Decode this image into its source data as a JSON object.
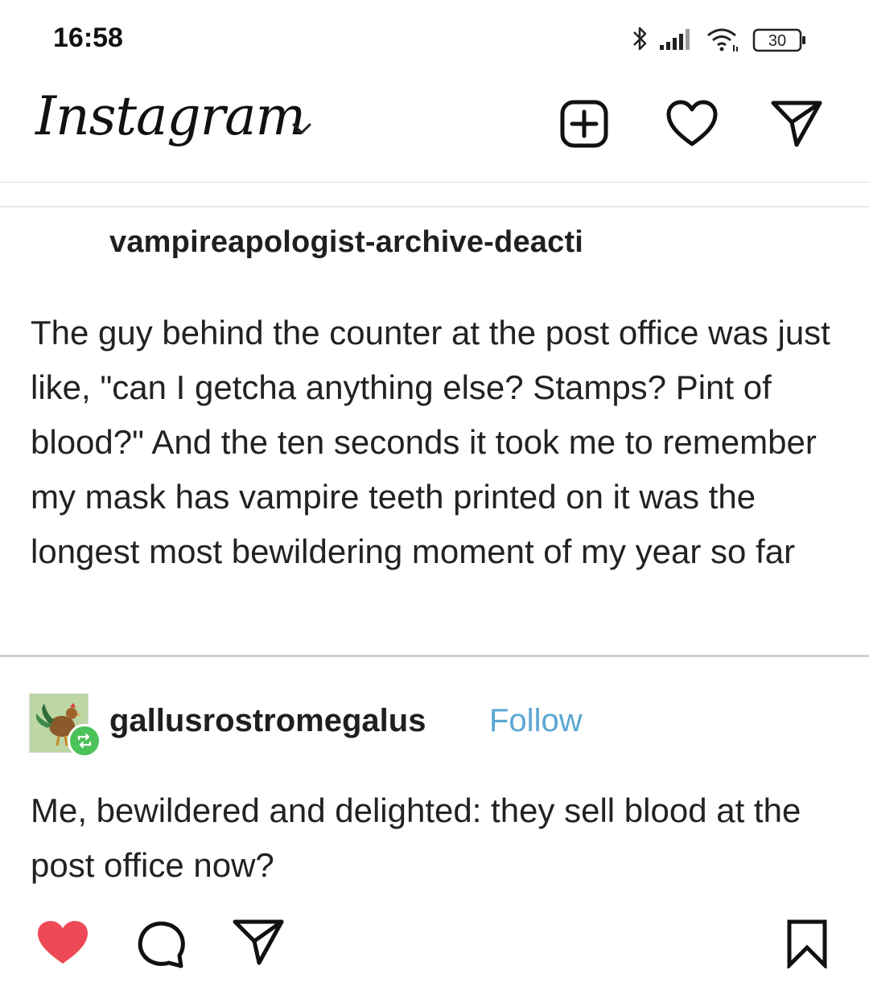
{
  "status_bar": {
    "time": "16:58",
    "battery": "30",
    "icons": [
      "bluetooth-icon",
      "signal-icon",
      "wifi-icon",
      "battery-icon"
    ]
  },
  "header": {
    "logo": "Instagram",
    "icons": [
      "chevron-down-icon",
      "new-post-icon",
      "heart-icon",
      "direct-message-icon"
    ]
  },
  "post": {
    "original": {
      "username": "vampireapologist-archive-deacti",
      "text": "The guy behind the counter at the post office was just like, \"can I getcha anything else? Stamps? Pint of blood?\" And the ten seconds it took me to remember my mask has vampire teeth printed on it was the longest most bewildering moment of my year so far"
    },
    "reply": {
      "username": "gallusrostromegalus",
      "follow_label": "Follow",
      "text": "Me, bewildered and delighted: they sell blood at the post office now?"
    }
  },
  "actions": {
    "icons": [
      "like-icon",
      "comment-icon",
      "share-icon",
      "save-icon"
    ],
    "like_color": "#ed4956"
  },
  "colors": {
    "follow": "#5aa7d4",
    "reblog_badge": "#4cc25a",
    "like": "#ed4956"
  }
}
